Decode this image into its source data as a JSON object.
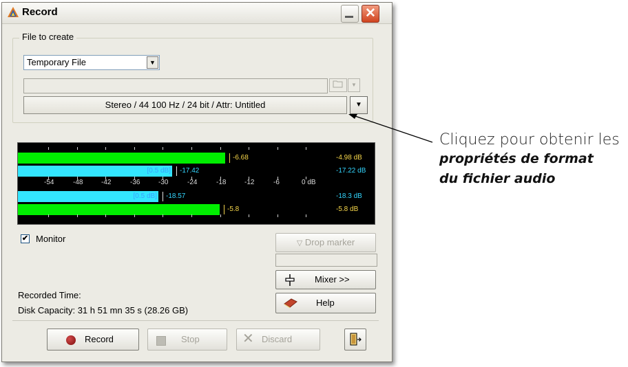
{
  "window": {
    "title": "Record"
  },
  "file_group": {
    "legend": "File to create",
    "file_type": "Temporary File",
    "path": "",
    "format": "Stereo / 44 100 Hz / 24 bit / Attr: Untitled"
  },
  "meter": {
    "scale": [
      "-54",
      "-48",
      "-42",
      "-36",
      "-30",
      "-24",
      "-18",
      "-12",
      "-6",
      "0 dB"
    ],
    "channels": [
      {
        "peak_label": "-6.68",
        "readout": "-4.98 dB",
        "level_fraction": 0.74
      },
      {
        "peak_label": "-17.42",
        "readout": "-17.22 dB",
        "bracket": "[0.5 dB]",
        "level_fraction": 0.55
      },
      {
        "peak_label": "-18.57",
        "readout": "-18.3 dB",
        "bracket": "[0.5 dB]",
        "level_fraction": 0.5
      },
      {
        "peak_label": "-5.8",
        "readout": "-5.8 dB",
        "level_fraction": 0.72
      }
    ],
    "colors": {
      "outer": "#00ee00",
      "inner": "#33e6ff",
      "peak": "#f2d34d",
      "readout_outer": "#f7d74a",
      "readout_inner": "#33d6ff"
    }
  },
  "monitor": {
    "label": "Monitor",
    "checked": "✔"
  },
  "buttons": {
    "drop_marker": "Drop marker",
    "mixer": "Mixer >>",
    "help": "Help",
    "record": "Record",
    "stop": "Stop",
    "discard": "Discard"
  },
  "status": {
    "recorded_time": "Recorded Time:",
    "disk_capacity": "Disk Capacity: 31 h 51 mn 35 s (28.26 GB)"
  },
  "annotation": {
    "line1": "Cliquez pour obtenir les",
    "line2": "propriétés de format",
    "line3": "du fichier audio"
  },
  "icons": [
    "app-triangle-icon",
    "minimize-icon",
    "close-icon",
    "folder-icon",
    "chevron-down-icon",
    "marker-icon",
    "mixer-fader-icon",
    "help-book-icon",
    "record-dot-icon",
    "stop-square-icon",
    "discard-x-icon",
    "exit-door-icon"
  ]
}
